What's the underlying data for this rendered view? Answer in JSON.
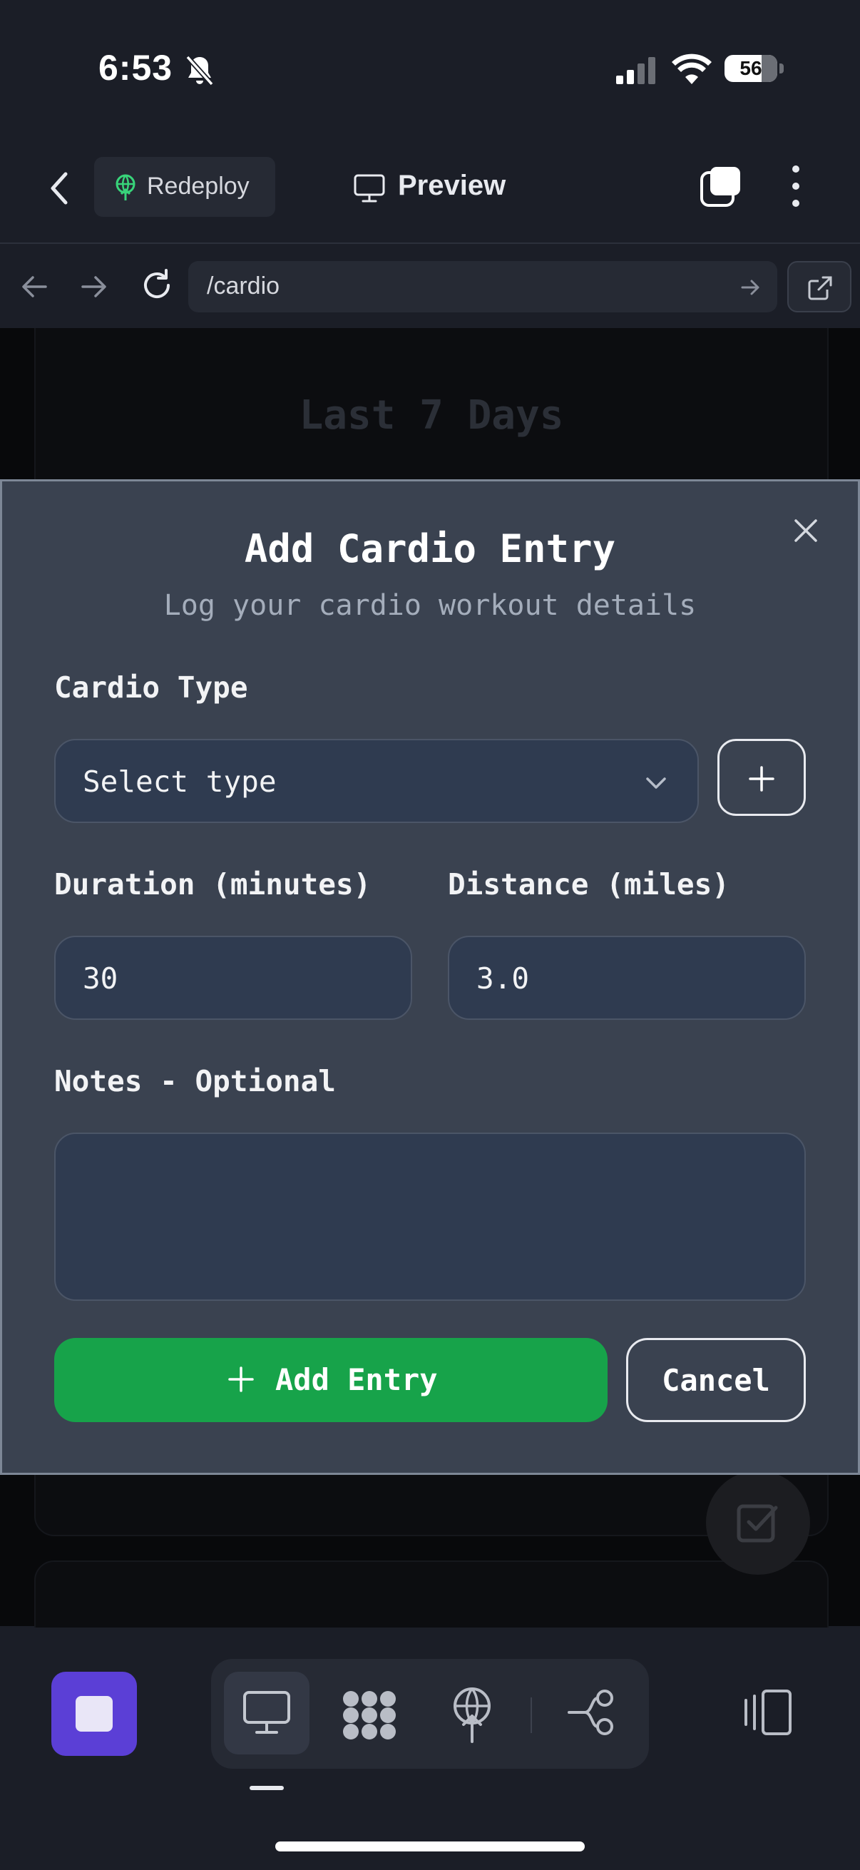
{
  "status_bar": {
    "time": "6:53",
    "battery": "56"
  },
  "header": {
    "redeploy_label": "Redeploy",
    "preview_label": "Preview"
  },
  "url_bar": {
    "path": "/cardio"
  },
  "background_page": {
    "card_title": "Last 7 Days"
  },
  "modal": {
    "title": "Add Cardio Entry",
    "subtitle": "Log your cardio workout details",
    "cardio_type": {
      "label": "Cardio Type",
      "selected": "Select type"
    },
    "duration": {
      "label": "Duration (minutes)",
      "value": "30"
    },
    "distance": {
      "label": "Distance (miles)",
      "value": "3.0"
    },
    "notes": {
      "label": "Notes - Optional",
      "value": ""
    },
    "add_button": "Add Entry",
    "cancel_button": "Cancel"
  },
  "colors": {
    "background": "#1b1e27",
    "modal": "#3a4250",
    "input": "#2f3b50",
    "primary": "#17a34a",
    "stop_button": "#5b3fd6"
  },
  "icons": {
    "status": [
      "bell-slash-icon",
      "signal-icon",
      "wifi-icon",
      "battery-icon"
    ],
    "header": [
      "chevron-left-icon",
      "redeploy-icon",
      "monitor-icon",
      "tabs-icon",
      "more-vertical-icon"
    ],
    "url_bar": [
      "arrow-left-icon",
      "arrow-right-icon",
      "reload-icon",
      "go-arrow-icon",
      "external-link-icon"
    ],
    "modal": [
      "close-icon",
      "chevron-down-icon",
      "plus-icon"
    ],
    "dock": [
      "stop-icon",
      "monitor-icon",
      "grid-icon",
      "deploy-icon",
      "share-icon",
      "panels-icon"
    ]
  }
}
